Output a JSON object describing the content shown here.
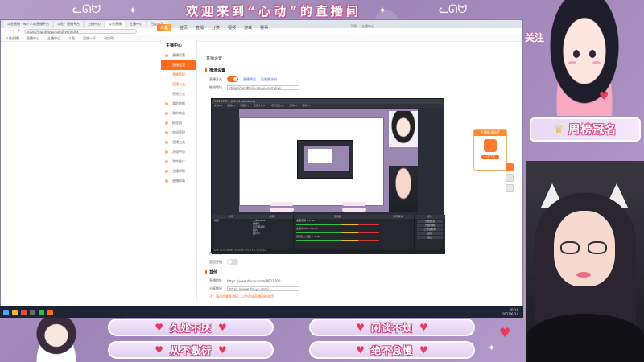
{
  "overlay": {
    "banner_title": "欢迎来到“心动”的直播间",
    "follow_label": "关注",
    "rank_label": "周榜冠名",
    "buttons": [
      {
        "label": "久处不厌"
      },
      {
        "label": "闲谈不烦"
      },
      {
        "label": "从不敷衍"
      },
      {
        "label": "绝不怠慢"
      }
    ],
    "colors": {
      "accent": "#d45a8e",
      "heart": "#e53b5f",
      "panel": "#b7a0c9"
    }
  },
  "browser": {
    "tabs": [
      "斗鱼直播 - 每个人的直播平台",
      "斗鱼 - 直播平台",
      "主播中心",
      "斗鱼直播",
      "主播中心",
      "百度一下"
    ],
    "address": "https://mp.douyu.com/live/index",
    "bookmarks": [
      "斗鱼直播",
      "直播中心",
      "主播中心",
      "斗鱼",
      "百度一下",
      "淘宝网"
    ]
  },
  "site": {
    "logo": "斗鱼",
    "nav": [
      "首页",
      "直播",
      "分类",
      "视频",
      "游戏",
      "赛事"
    ],
    "right_items": [
      "下载",
      "主播中心"
    ]
  },
  "sidebar": {
    "head": "主播中心",
    "items": [
      {
        "label": "直播设置",
        "state": "normal"
      },
      {
        "label": "直播设置",
        "state": "active"
      },
      {
        "label": "直播管理",
        "state": "sub"
      },
      {
        "label": "直播公告",
        "state": "sub"
      },
      {
        "label": "直播分类",
        "state": "plain"
      },
      {
        "label": "我的数据",
        "state": "normal"
      },
      {
        "label": "我的收益",
        "state": "normal"
      },
      {
        "label": "粉丝团",
        "state": "normal"
      },
      {
        "label": "房间管理",
        "state": "normal"
      },
      {
        "label": "直播工具",
        "state": "normal"
      },
      {
        "label": "活动中心",
        "state": "normal"
      },
      {
        "label": "我的推广",
        "state": "normal"
      },
      {
        "label": "主播学院",
        "state": "normal"
      },
      {
        "label": "直播帮助",
        "state": "normal"
      }
    ]
  },
  "panel": {
    "title": "直播设置",
    "section1": "推流设置",
    "row_label": "直播开关",
    "link1": "直播预览",
    "link2": "复制推流码",
    "field_label": "推流地址",
    "field_value": "rtmp://sendtc3a.douyu.com/live",
    "row2_label": "房间标题",
    "row3_label": "是否开播",
    "section2": "其他",
    "url1_label": "直播地址",
    "url1": "https://www.douyu.com/8811000",
    "url2_label": "分享链接",
    "url2": "https://www.douyu.com/",
    "note": "注：请勿泄露推流码，以免造成直播间被盗用"
  },
  "float_widget": {
    "title": "主播推流助手",
    "button": "立即下载"
  },
  "obs": {
    "title": "OBS 27.0.1 (64-bit, windows)",
    "menu": [
      "文件(F)",
      "编辑(E)",
      "视图(V)",
      "配置文件(P)",
      "场景集合(S)",
      "工具(T)",
      "帮助(H)"
    ],
    "docks": {
      "scenes_head": "场景",
      "scenes": [
        "场景"
      ],
      "sources_head": "来源",
      "sources": [
        "文本 (GDI+)",
        "摄像头",
        "显示器采集",
        "图片",
        "图片 2"
      ],
      "mixer_head": "混音器",
      "mixer": [
        {
          "name": "桌面音频",
          "level": "0.0 dB"
        },
        {
          "name": "麦克风/Aux",
          "level": "0.0 dB"
        },
        {
          "name": "音频输入采集",
          "level": "0.0 dB"
        }
      ],
      "transitions_head": "转场特效",
      "controls_head": "控件",
      "controls": [
        "开始推流",
        "开始录制",
        "工作室模式",
        "设置",
        "退出"
      ]
    },
    "status": "LIVE: 00:00:00  REC: 00:00:00  CPU: 3.5%, 30.00 fps"
  },
  "taskbar": {
    "time": "20:18",
    "date": "2021/6/24"
  }
}
